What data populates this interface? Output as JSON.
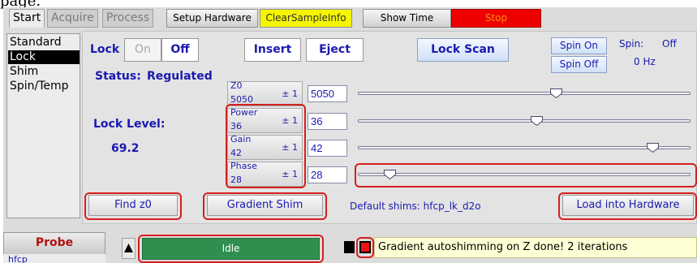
{
  "page_caption": "page.",
  "tabs": [
    {
      "label": "Start"
    },
    {
      "label": "Acquire"
    },
    {
      "label": "Process"
    }
  ],
  "toolbar": {
    "setup_hardware": "Setup Hardware",
    "clear_sample_info": "ClearSampleInfo",
    "show_time": "Show Time",
    "stop": "Stop"
  },
  "sidebar": {
    "items": [
      {
        "label": "Standard"
      },
      {
        "label": "Lock"
      },
      {
        "label": "Shim"
      },
      {
        "label": "Spin/Temp"
      }
    ],
    "selected": "Lock"
  },
  "lock": {
    "label": "Lock",
    "on": "On",
    "off": "Off",
    "insert": "Insert",
    "eject": "Eject",
    "lock_scan": "Lock Scan",
    "status_label": "Status:",
    "status_value": "Regulated",
    "level_label": "Lock Level:",
    "level_value": "69.2"
  },
  "spin": {
    "spin_on": "Spin On",
    "spin_off": "Spin Off",
    "label": "Spin:",
    "state": "Off",
    "rate": "0 Hz"
  },
  "params": [
    {
      "name": "Z0",
      "value": "5050",
      "step": "± 1",
      "field": "5050",
      "slider_fraction": 0.6
    },
    {
      "name": "Power",
      "value": "36",
      "step": "± 1",
      "field": "36",
      "slider_fraction": 0.54
    },
    {
      "name": "Gain",
      "value": "42",
      "step": "± 1",
      "field": "42",
      "slider_fraction": 0.9
    },
    {
      "name": "Phase",
      "value": "28",
      "step": "± 1",
      "field": "28",
      "slider_fraction": 0.08
    }
  ],
  "actions": {
    "find_z0": "Find z0",
    "gradient_shim": "Gradient Shim",
    "default_shims": "Default shims: hfcp_lk_d2o",
    "load_into_hardware": "Load into Hardware"
  },
  "bottom": {
    "probe_label": "Probe",
    "probe_value": "hfcp",
    "status": "Idle",
    "message": "Gradient autoshimming on Z done!  2 iterations"
  },
  "colors": {
    "label_blue": "#1a1ab0",
    "highlight_red": "#d51f1f",
    "idle_green": "#2f8f4f",
    "stop_red": "#ee0000",
    "clear_yellow": "#f5f500",
    "message_bg": "#ffffd6"
  },
  "icons": {
    "up_arrow": "triangle-up-icon",
    "black_square": "square-icon",
    "red_square": "red-square-icon",
    "slider_thumb": "pentagon-thumb-icon"
  }
}
